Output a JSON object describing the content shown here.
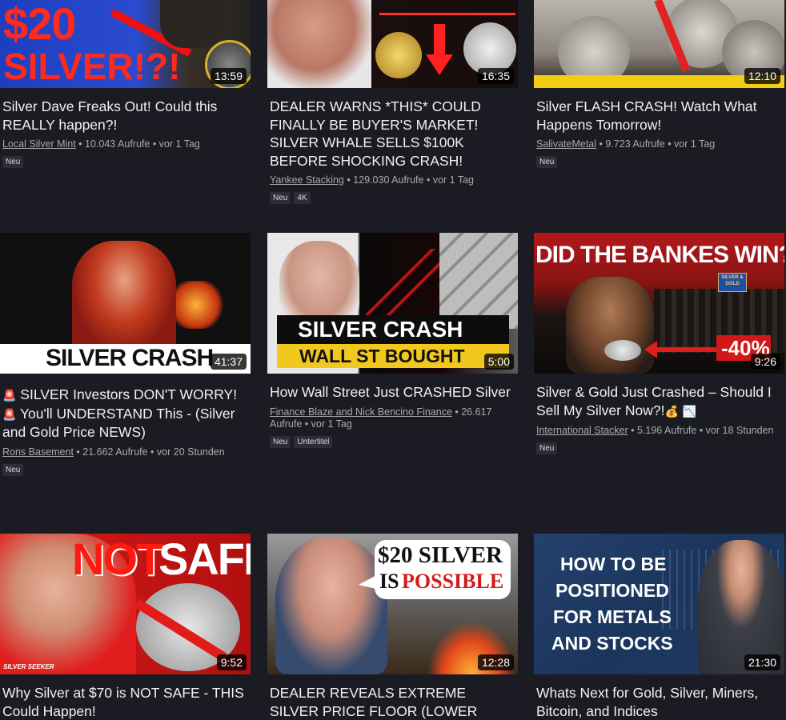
{
  "videos": [
    {
      "title": "Silver Dave Freaks Out! Could this REALLY happen?!",
      "channel": "Local Silver Mint",
      "stats": " • 10.043 Aufrufe • vor 1 Tag",
      "duration": "13:59",
      "badges": [
        "Neu"
      ],
      "thumb_text": [
        "$20",
        "SILVER!?!"
      ]
    },
    {
      "title": "DEALER WARNS *THIS* COULD FINALLY BE BUYER'S MARKET! SILVER WHALE SELLS $100K BEFORE SHOCKING CRASH!",
      "channel": "Yankee Stacking",
      "stats": " • 129.030 Aufrufe • vor 1 Tag",
      "duration": "16:35",
      "badges": [
        "Neu",
        "4K"
      ]
    },
    {
      "title": "Silver FLASH CRASH! Watch What Happens Tomorrow!",
      "channel": "SalivateMetal",
      "stats": " • 9.723 Aufrufe • vor 1 Tag",
      "duration": "12:10",
      "badges": [
        "Neu"
      ]
    },
    {
      "title_prefix_icon": "🚨",
      "title_part1": " SILVER Investors DON'T WORRY! ",
      "title_mid_icon": "🚨",
      "title_part2": " You'll UNDERSTAND This - (Silver and Gold Price NEWS)",
      "channel": "Rons Basement",
      "stats": " • 21.662 Aufrufe • vor 20 Stunden",
      "duration": "41:37",
      "badges": [
        "Neu"
      ],
      "thumb_text": [
        "SILVER CRASH"
      ]
    },
    {
      "title": "How Wall Street Just CRASHED Silver",
      "channel": "Finance Blaze and Nick Bencino Finance",
      "stats": " • 26.617 Aufrufe • vor 1 Tag",
      "duration": "5:00",
      "badges": [
        "Neu",
        "Untertitel"
      ],
      "thumb_text": [
        "SILVER CRASH",
        "WALL ST BOUGHT"
      ]
    },
    {
      "title": "Silver & Gold Just Crashed – Should I Sell My Silver Now?!",
      "title_icons": [
        "💰",
        "📉"
      ],
      "channel": "International Stacker",
      "stats": " • 5.196 Aufrufe • vor 18 Stunden",
      "duration": "9:26",
      "badges": [
        "Neu"
      ],
      "thumb_text": [
        "DID THE BANKES WIN?",
        "-40%",
        "SILVER & GOLD"
      ]
    },
    {
      "title": "Why Silver at $70 is NOT SAFE - THIS Could Happen!",
      "duration": "9:52",
      "thumb_text": [
        "NOT",
        "SAFE",
        "SILVER SEEKER"
      ]
    },
    {
      "title": "DEALER REVEALS EXTREME SILVER PRICE FLOOR (LOWER",
      "duration": "12:28",
      "thumb_text": [
        "$20 SILVER",
        "IS",
        "POSSIBLE"
      ]
    },
    {
      "title": "Whats Next for Gold, Silver, Miners, Bitcoin, and Indices",
      "duration": "21:30",
      "thumb_text": [
        "HOW TO BE",
        "POSITIONED",
        "FOR METALS",
        "AND STOCKS"
      ]
    }
  ],
  "colors": {
    "background": "#1b1b24",
    "text": "#f1f1f1",
    "meta": "#aaaaaa",
    "badge_bg": "#2d2d38"
  }
}
